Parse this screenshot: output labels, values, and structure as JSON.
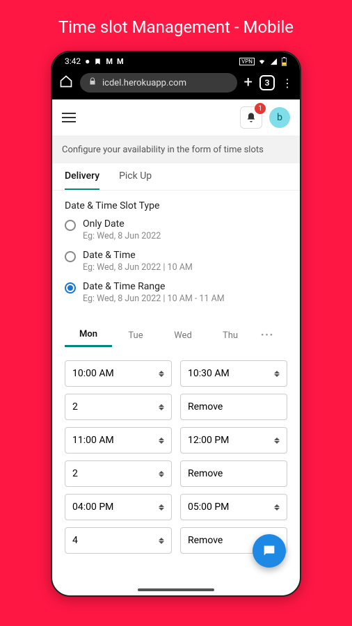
{
  "page": {
    "title": "Time slot Management - Mobile"
  },
  "statusbar": {
    "time": "3:42",
    "icons_left": [
      "dot",
      "bookmark",
      "M",
      "M"
    ],
    "icons_right": [
      "vpn",
      "wifi",
      "signal",
      "battery"
    ]
  },
  "browser": {
    "url_display": "icdel.herokuapp.com",
    "tab_count": "3"
  },
  "header": {
    "notification_count": "1",
    "avatar_initial": "b"
  },
  "info_strip": "Configure your availability in the form of time slots",
  "primary_tabs": {
    "items": [
      "Delivery",
      "Pick Up"
    ],
    "active_index": 0
  },
  "slot_type": {
    "section_title": "Date & Time Slot Type",
    "options": [
      {
        "label": "Only Date",
        "example": "Eg: Wed, 8 Jun 2022",
        "selected": false
      },
      {
        "label": "Date & Time",
        "example": "Eg: Wed, 8 Jun 2022 | 10 AM",
        "selected": false
      },
      {
        "label": "Date & Time Range",
        "example": "Eg: Wed, 8 Jun 2022 | 10 AM - 11 AM",
        "selected": true
      }
    ]
  },
  "day_tabs": {
    "items": [
      "Mon",
      "Tue",
      "Wed",
      "Thu"
    ],
    "more": "•••",
    "active_index": 0
  },
  "slots": [
    {
      "start": "10:00 AM",
      "end": "10:30 AM",
      "qty": "2",
      "remove": "Remove"
    },
    {
      "start": "11:00 AM",
      "end": "12:00 PM",
      "qty": "2",
      "remove": "Remove"
    },
    {
      "start": "04:00 PM",
      "end": "05:00 PM",
      "qty": "4",
      "remove": "Remove"
    }
  ],
  "colors": {
    "accent": "#00897b",
    "background": "#ff1744",
    "fab": "#1e88e5"
  }
}
